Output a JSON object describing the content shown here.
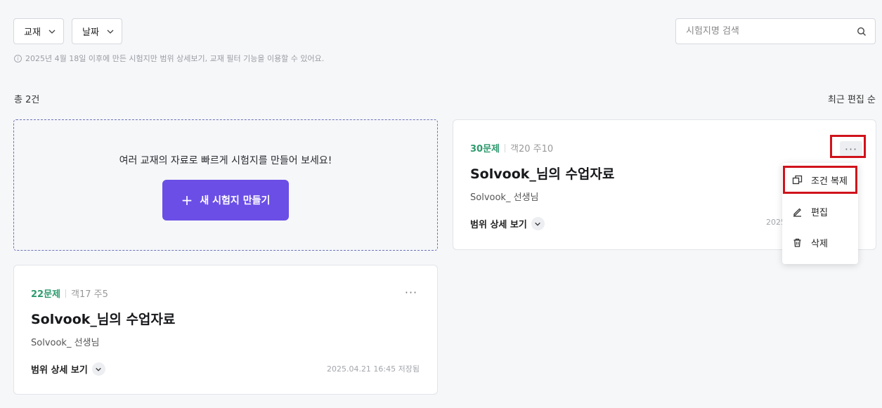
{
  "filters": {
    "textbook_label": "교재",
    "date_label": "날짜"
  },
  "search": {
    "placeholder": "시험지명 검색"
  },
  "notice": "2025년 4월 18일 이후에 만든 시험지만 범위 상세보기, 교재 필터 기능을 이용할 수 있어요.",
  "total": "총 2건",
  "sort": "최근 편집 순",
  "create_card": {
    "message": "여러 교재의 자료로 빠르게 시험지를 만들어 보세요!",
    "button_label": "새 시험지 만들기"
  },
  "cards": [
    {
      "count": "30문제",
      "detail": "객20 주10",
      "title": "Solvook_님의 수업자료",
      "author": "Solvook_ 선생님",
      "range_label": "범위 상세 보기",
      "saved": "2025"
    },
    {
      "count": "22문제",
      "detail": "객17 주5",
      "title": "Solvook_님의 수업자료",
      "author": "Solvook_ 선생님",
      "range_label": "범위 상세 보기",
      "saved": "2025.04.21 16:45 저장됨"
    }
  ],
  "menu": {
    "items": [
      {
        "label": "조건 복제",
        "icon": "copy-icon"
      },
      {
        "label": "편집",
        "icon": "pencil-icon"
      },
      {
        "label": "삭제",
        "icon": "trash-icon"
      }
    ]
  },
  "colors": {
    "accent": "#6b4ee6",
    "count_green": "#2e9b6e",
    "highlight_red": "#d0121b"
  }
}
